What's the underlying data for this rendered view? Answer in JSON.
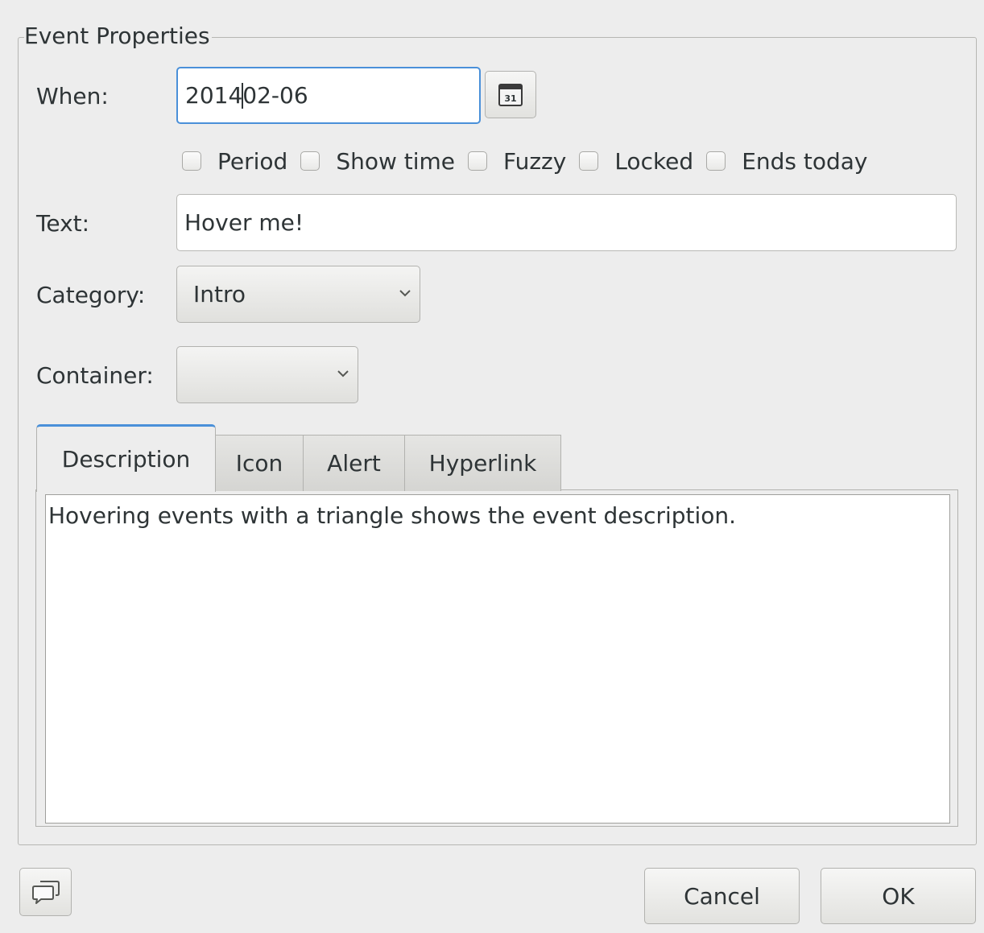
{
  "dialog": {
    "frame_title": "Event Properties",
    "when": {
      "label": "When:",
      "value_before_cursor": "2014",
      "value_after_cursor": "02-06",
      "calendar_button_icon": "calendar-icon",
      "calendar_icon_text": "31"
    },
    "checkboxes": [
      {
        "label": "Period",
        "checked": false
      },
      {
        "label": "Show time",
        "checked": false
      },
      {
        "label": "Fuzzy",
        "checked": false
      },
      {
        "label": "Locked",
        "checked": false
      },
      {
        "label": "Ends today",
        "checked": false
      }
    ],
    "text": {
      "label": "Text:",
      "value": "Hover me!"
    },
    "category": {
      "label": "Category:",
      "selected": "Intro"
    },
    "container": {
      "label": "Container:",
      "selected": ""
    },
    "tabs": [
      {
        "label": "Description",
        "active": true
      },
      {
        "label": "Icon",
        "active": false
      },
      {
        "label": "Alert",
        "active": false
      },
      {
        "label": "Hyperlink",
        "active": false
      }
    ],
    "description_text": "Hovering events with a triangle shows the event description.",
    "footer": {
      "feedback_icon": "speech-bubbles-icon",
      "cancel_label": "Cancel",
      "ok_label": "OK"
    }
  },
  "colors": {
    "background": "#ededed",
    "focus_accent": "#4a90d9",
    "text": "#2e3436"
  }
}
